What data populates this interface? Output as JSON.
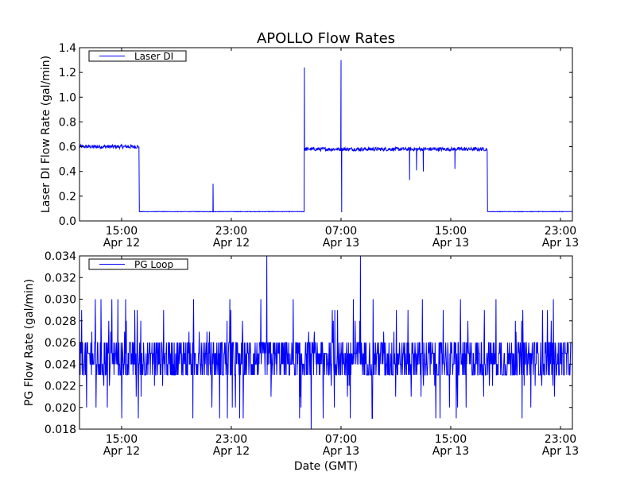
{
  "chart_data": [
    {
      "type": "line",
      "title": "APOLLO Flow Rates",
      "ylabel": "Laser DI Flow Rate (gal/min)",
      "xlabel": "",
      "x_units": "hours since Apr 12 00:00 GMT",
      "xlim": [
        11.93,
        47.87
      ],
      "ylim": [
        0,
        1.4
      ],
      "yticks": [
        "0.0",
        "0.2",
        "0.4",
        "0.6",
        "0.8",
        "1.0",
        "1.2",
        "1.4"
      ],
      "ytick_values": [
        0,
        0.2,
        0.4,
        0.6,
        0.8,
        1.0,
        1.2,
        1.4
      ],
      "xticks": [
        {
          "time": "15:00",
          "date": "Apr 12"
        },
        {
          "time": "23:00",
          "date": "Apr 12"
        },
        {
          "time": "07:00",
          "date": "Apr 13"
        },
        {
          "time": "15:00",
          "date": "Apr 13"
        },
        {
          "time": "23:00",
          "date": "Apr 13"
        }
      ],
      "xtick_values": [
        15,
        23,
        31,
        39,
        47
      ],
      "legend": {
        "label": "Laser DI",
        "placement": "top-left"
      },
      "color": "#0000ff",
      "series": [
        {
          "name": "Laser DI",
          "levels": [
            {
              "from": 11.93,
              "to": 16.28,
              "value": 0.6,
              "noise": 0.015
            },
            {
              "from": 16.28,
              "to": 28.33,
              "value": 0.075,
              "noise": 0.002
            },
            {
              "from": 28.33,
              "to": 41.67,
              "value": 0.58,
              "noise": 0.015
            },
            {
              "from": 41.67,
              "to": 47.87,
              "value": 0.075,
              "noise": 0.002
            }
          ],
          "spikes": [
            {
              "x": 21.67,
              "y": 0.3
            },
            {
              "x": 28.33,
              "y": 1.24
            },
            {
              "x": 31.0,
              "y": 1.3
            },
            {
              "x": 31.05,
              "y": 0.07
            },
            {
              "x": 36.0,
              "y": 0.33
            },
            {
              "x": 36.5,
              "y": 0.41
            },
            {
              "x": 37.0,
              "y": 0.4
            },
            {
              "x": 39.3,
              "y": 0.42
            }
          ]
        }
      ]
    },
    {
      "type": "line",
      "ylabel": "PG Flow Rate (gal/min)",
      "xlabel": "Date (GMT)",
      "xlim": [
        11.93,
        47.87
      ],
      "ylim": [
        0.018,
        0.034
      ],
      "yticks": [
        "0.018",
        "0.020",
        "0.022",
        "0.024",
        "0.026",
        "0.028",
        "0.030",
        "0.032",
        "0.034"
      ],
      "ytick_values": [
        0.018,
        0.02,
        0.022,
        0.024,
        0.026,
        0.028,
        0.03,
        0.032,
        0.034
      ],
      "xticks": [
        {
          "time": "15:00",
          "date": "Apr 12"
        },
        {
          "time": "23:00",
          "date": "Apr 12"
        },
        {
          "time": "07:00",
          "date": "Apr 13"
        },
        {
          "time": "15:00",
          "date": "Apr 13"
        },
        {
          "time": "23:00",
          "date": "Apr 13"
        }
      ],
      "xtick_values": [
        15,
        23,
        31,
        39,
        47
      ],
      "legend": {
        "label": "PG Loop",
        "placement": "top-left"
      },
      "color": "#0000ff",
      "series": [
        {
          "name": "PG Loop",
          "base_range": [
            0.023,
            0.026
          ],
          "min": 0.018,
          "max": 0.034,
          "resolution": 0.001
        }
      ]
    }
  ]
}
